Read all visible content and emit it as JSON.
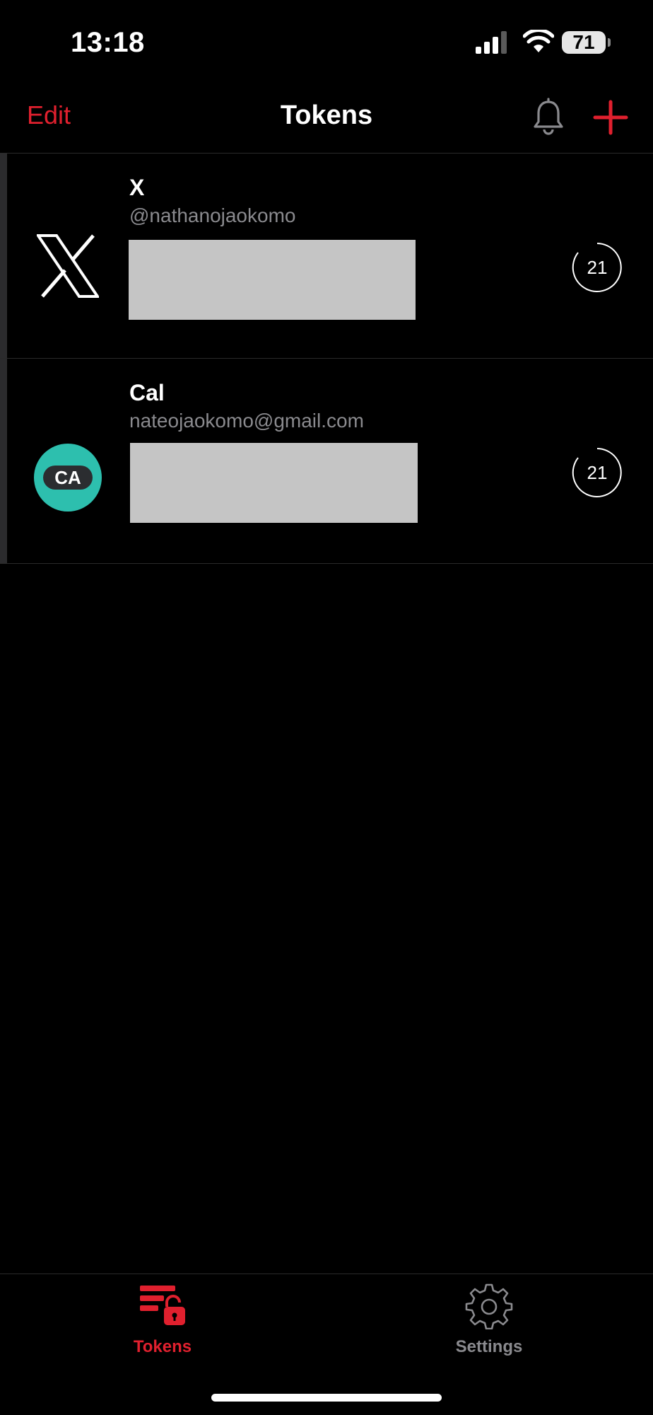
{
  "status_bar": {
    "time": "13:18",
    "battery": "71"
  },
  "nav": {
    "edit_label": "Edit",
    "title": "Tokens"
  },
  "tokens": [
    {
      "issuer": "X",
      "account": "@nathanojaokomo",
      "countdown": "21",
      "logo": "x-logo-icon"
    },
    {
      "issuer": "Cal",
      "account": "nateojaokomo@gmail.com",
      "countdown": "21",
      "logo": "avatar",
      "avatar_text": "CA",
      "avatar_color": "#2dbfae"
    }
  ],
  "tabbar": {
    "tokens_label": "Tokens",
    "settings_label": "Settings"
  },
  "colors": {
    "accent": "#e0202e",
    "background": "#000000",
    "secondary_text": "#8a8a8e"
  }
}
